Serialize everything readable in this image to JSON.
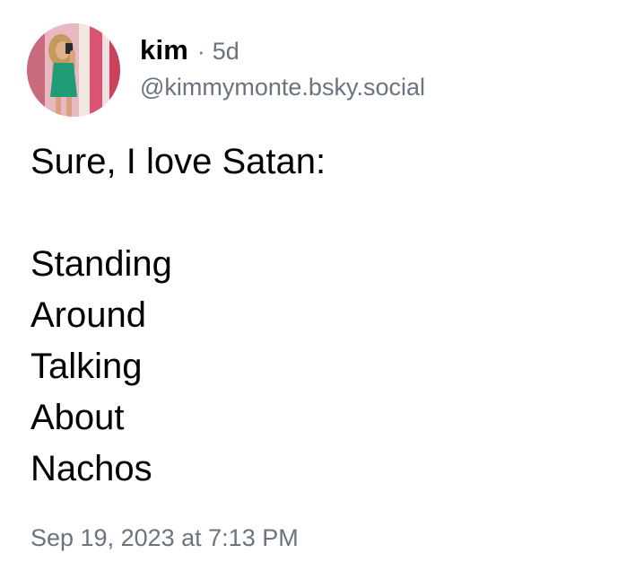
{
  "post": {
    "author": {
      "display_name": "kim",
      "separator": "·",
      "age": "5d",
      "handle": "@kimmymonte.bsky.social",
      "avatar": "profile-photo"
    },
    "text_lines": [
      "Sure, I love Satan:",
      "",
      "Standing",
      "Around",
      "Talking",
      "About",
      "Nachos"
    ],
    "timestamp": "Sep 19, 2023 at 7:13 PM"
  },
  "colors": {
    "text": "#000000",
    "secondary_text": "#6b7280",
    "background": "#ffffff"
  }
}
